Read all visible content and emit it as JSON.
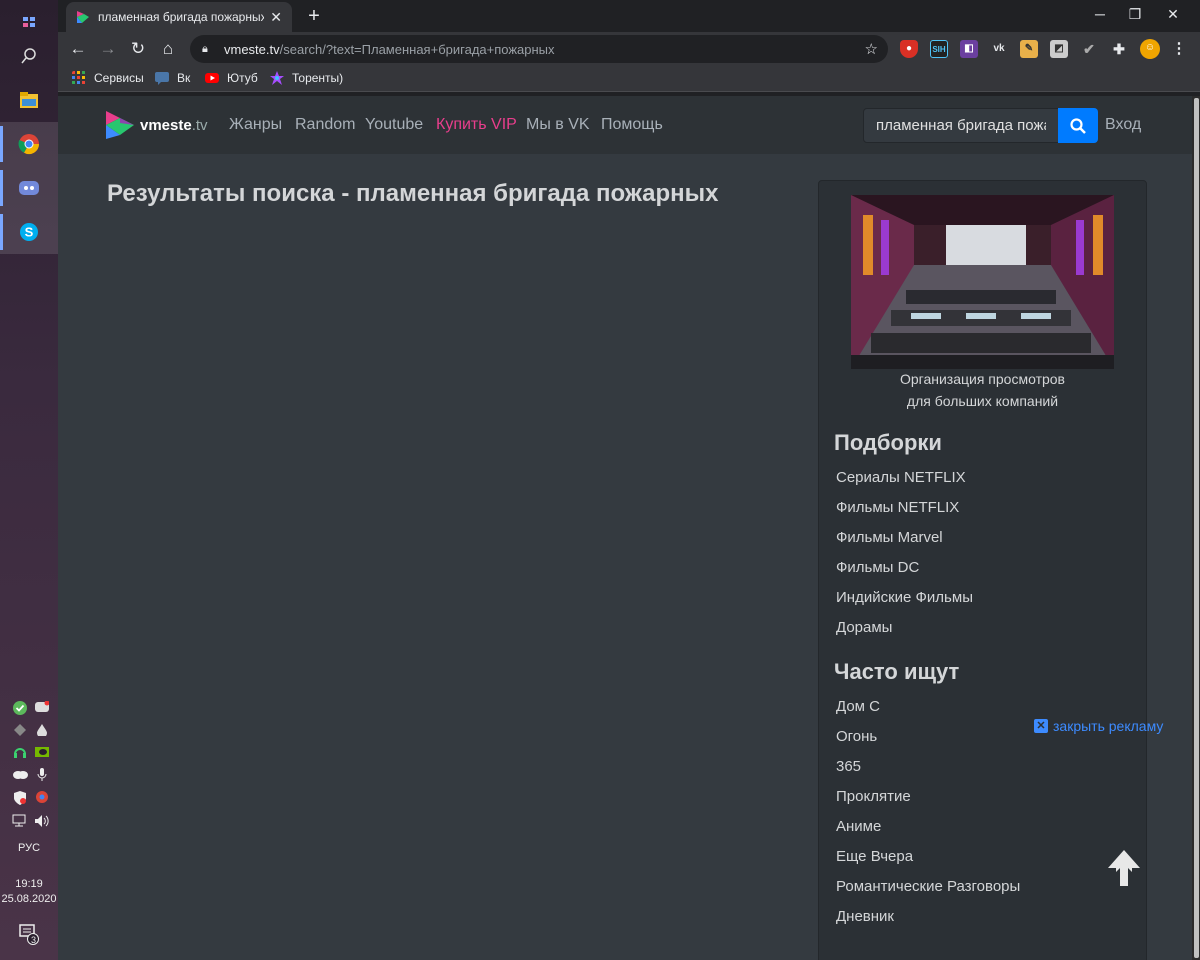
{
  "taskbar": {
    "language": "РУС",
    "time": "19:19",
    "date": "25.08.2020",
    "notifications_count": "3"
  },
  "browser": {
    "tab_title": "пламенная бригада пожарных",
    "url_host": "vmeste.tv",
    "url_path": "/search/?text=Пламенная+бригада+пожарных",
    "bookmarks": [
      "Сервисы",
      "Вк",
      "Ютуб",
      "Торенты)"
    ]
  },
  "site": {
    "logo_text": "vmeste",
    "logo_tld": ".tv",
    "nav": [
      "Жанры",
      "Random",
      "Youtube",
      "Купить VIP",
      "Мы в VK",
      "Помощь"
    ],
    "search_value": "пламенная бригада пожарных",
    "login_label": "Вход"
  },
  "main": {
    "results_title": "Результаты поиска - пламенная бригада пожарных"
  },
  "sidebar": {
    "promo_caption_line1": "Организация просмотров",
    "promo_caption_line2": "для больших компаний",
    "collections_heading": "Подборки",
    "collections": [
      "Сериалы NETFLIX",
      "Фильмы NETFLIX",
      "Фильмы Marvel",
      "Фильмы DC",
      "Индийские Фильмы",
      "Дорамы"
    ],
    "popular_heading": "Часто ищут",
    "popular": [
      "Дом С",
      "Огонь",
      "365",
      "Проклятие",
      "Аниме",
      "Еще Вчера",
      "Романтические Разговоры",
      "Дневник"
    ]
  },
  "ad": {
    "close_label": "закрыть рекламу"
  },
  "colors": {
    "accent": "#007bff",
    "vip": "#e83e8c",
    "page_bg": "#343a40"
  }
}
